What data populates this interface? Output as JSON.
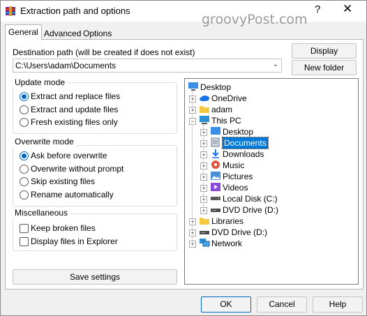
{
  "window": {
    "title": "Extraction path and options",
    "help_glyph": "?",
    "close_glyph": "✕",
    "watermark": "groovyPost.com"
  },
  "tabs": [
    {
      "label": "General",
      "active": true
    },
    {
      "label": "Advanced",
      "active": false
    },
    {
      "label": "Options",
      "active": false
    }
  ],
  "destination": {
    "label": "Destination path (will be created if does not exist)",
    "value": "C:\\Users\\adam\\Documents",
    "dropdown_glyph": "⌄"
  },
  "buttons": {
    "display": "Display",
    "new_folder": "New folder",
    "save_settings": "Save settings",
    "ok": "OK",
    "cancel": "Cancel",
    "help": "Help"
  },
  "update_mode": {
    "title": "Update mode",
    "options": [
      {
        "label": "Extract and replace files",
        "selected": true
      },
      {
        "label": "Extract and update files",
        "selected": false
      },
      {
        "label": "Fresh existing files only",
        "selected": false
      }
    ]
  },
  "overwrite_mode": {
    "title": "Overwrite mode",
    "options": [
      {
        "label": "Ask before overwrite",
        "selected": true
      },
      {
        "label": "Overwrite without prompt",
        "selected": false
      },
      {
        "label": "Skip existing files",
        "selected": false
      },
      {
        "label": "Rename automatically",
        "selected": false
      }
    ]
  },
  "misc": {
    "title": "Miscellaneous",
    "options": [
      {
        "label": "Keep broken files",
        "checked": false
      },
      {
        "label": "Display files in Explorer",
        "checked": false
      }
    ]
  },
  "tree": {
    "nodes": [
      {
        "label": "Desktop",
        "icon": "desktop-icon",
        "level": 0,
        "expander": ""
      },
      {
        "label": "OneDrive",
        "icon": "cloud-icon",
        "level": 1,
        "expander": "+"
      },
      {
        "label": "adam",
        "icon": "folder-icon",
        "level": 1,
        "expander": "+"
      },
      {
        "label": "This PC",
        "icon": "computer-icon",
        "level": 1,
        "expander": "−"
      },
      {
        "label": "Desktop",
        "icon": "desktop-icon",
        "level": 2,
        "expander": "+"
      },
      {
        "label": "Documents",
        "icon": "documents-icon",
        "level": 2,
        "expander": "+",
        "selected": true
      },
      {
        "label": "Downloads",
        "icon": "download-icon",
        "level": 2,
        "expander": "+"
      },
      {
        "label": "Music",
        "icon": "music-icon",
        "level": 2,
        "expander": "+"
      },
      {
        "label": "Pictures",
        "icon": "pictures-icon",
        "level": 2,
        "expander": "+"
      },
      {
        "label": "Videos",
        "icon": "videos-icon",
        "level": 2,
        "expander": "+"
      },
      {
        "label": "Local Disk (C:)",
        "icon": "disk-icon",
        "level": 2,
        "expander": "+"
      },
      {
        "label": "DVD Drive (D:)",
        "icon": "dvd-drive-icon",
        "level": 2,
        "expander": "+"
      },
      {
        "label": "Libraries",
        "icon": "folder-icon",
        "level": 1,
        "expander": "+"
      },
      {
        "label": "DVD Drive (D:)",
        "icon": "dvd-drive-icon",
        "level": 1,
        "expander": "+"
      },
      {
        "label": "Network",
        "icon": "network-icon",
        "level": 1,
        "expander": "+"
      }
    ]
  },
  "colors": {
    "accent": "#0067c0",
    "selection": "#0078d7"
  }
}
